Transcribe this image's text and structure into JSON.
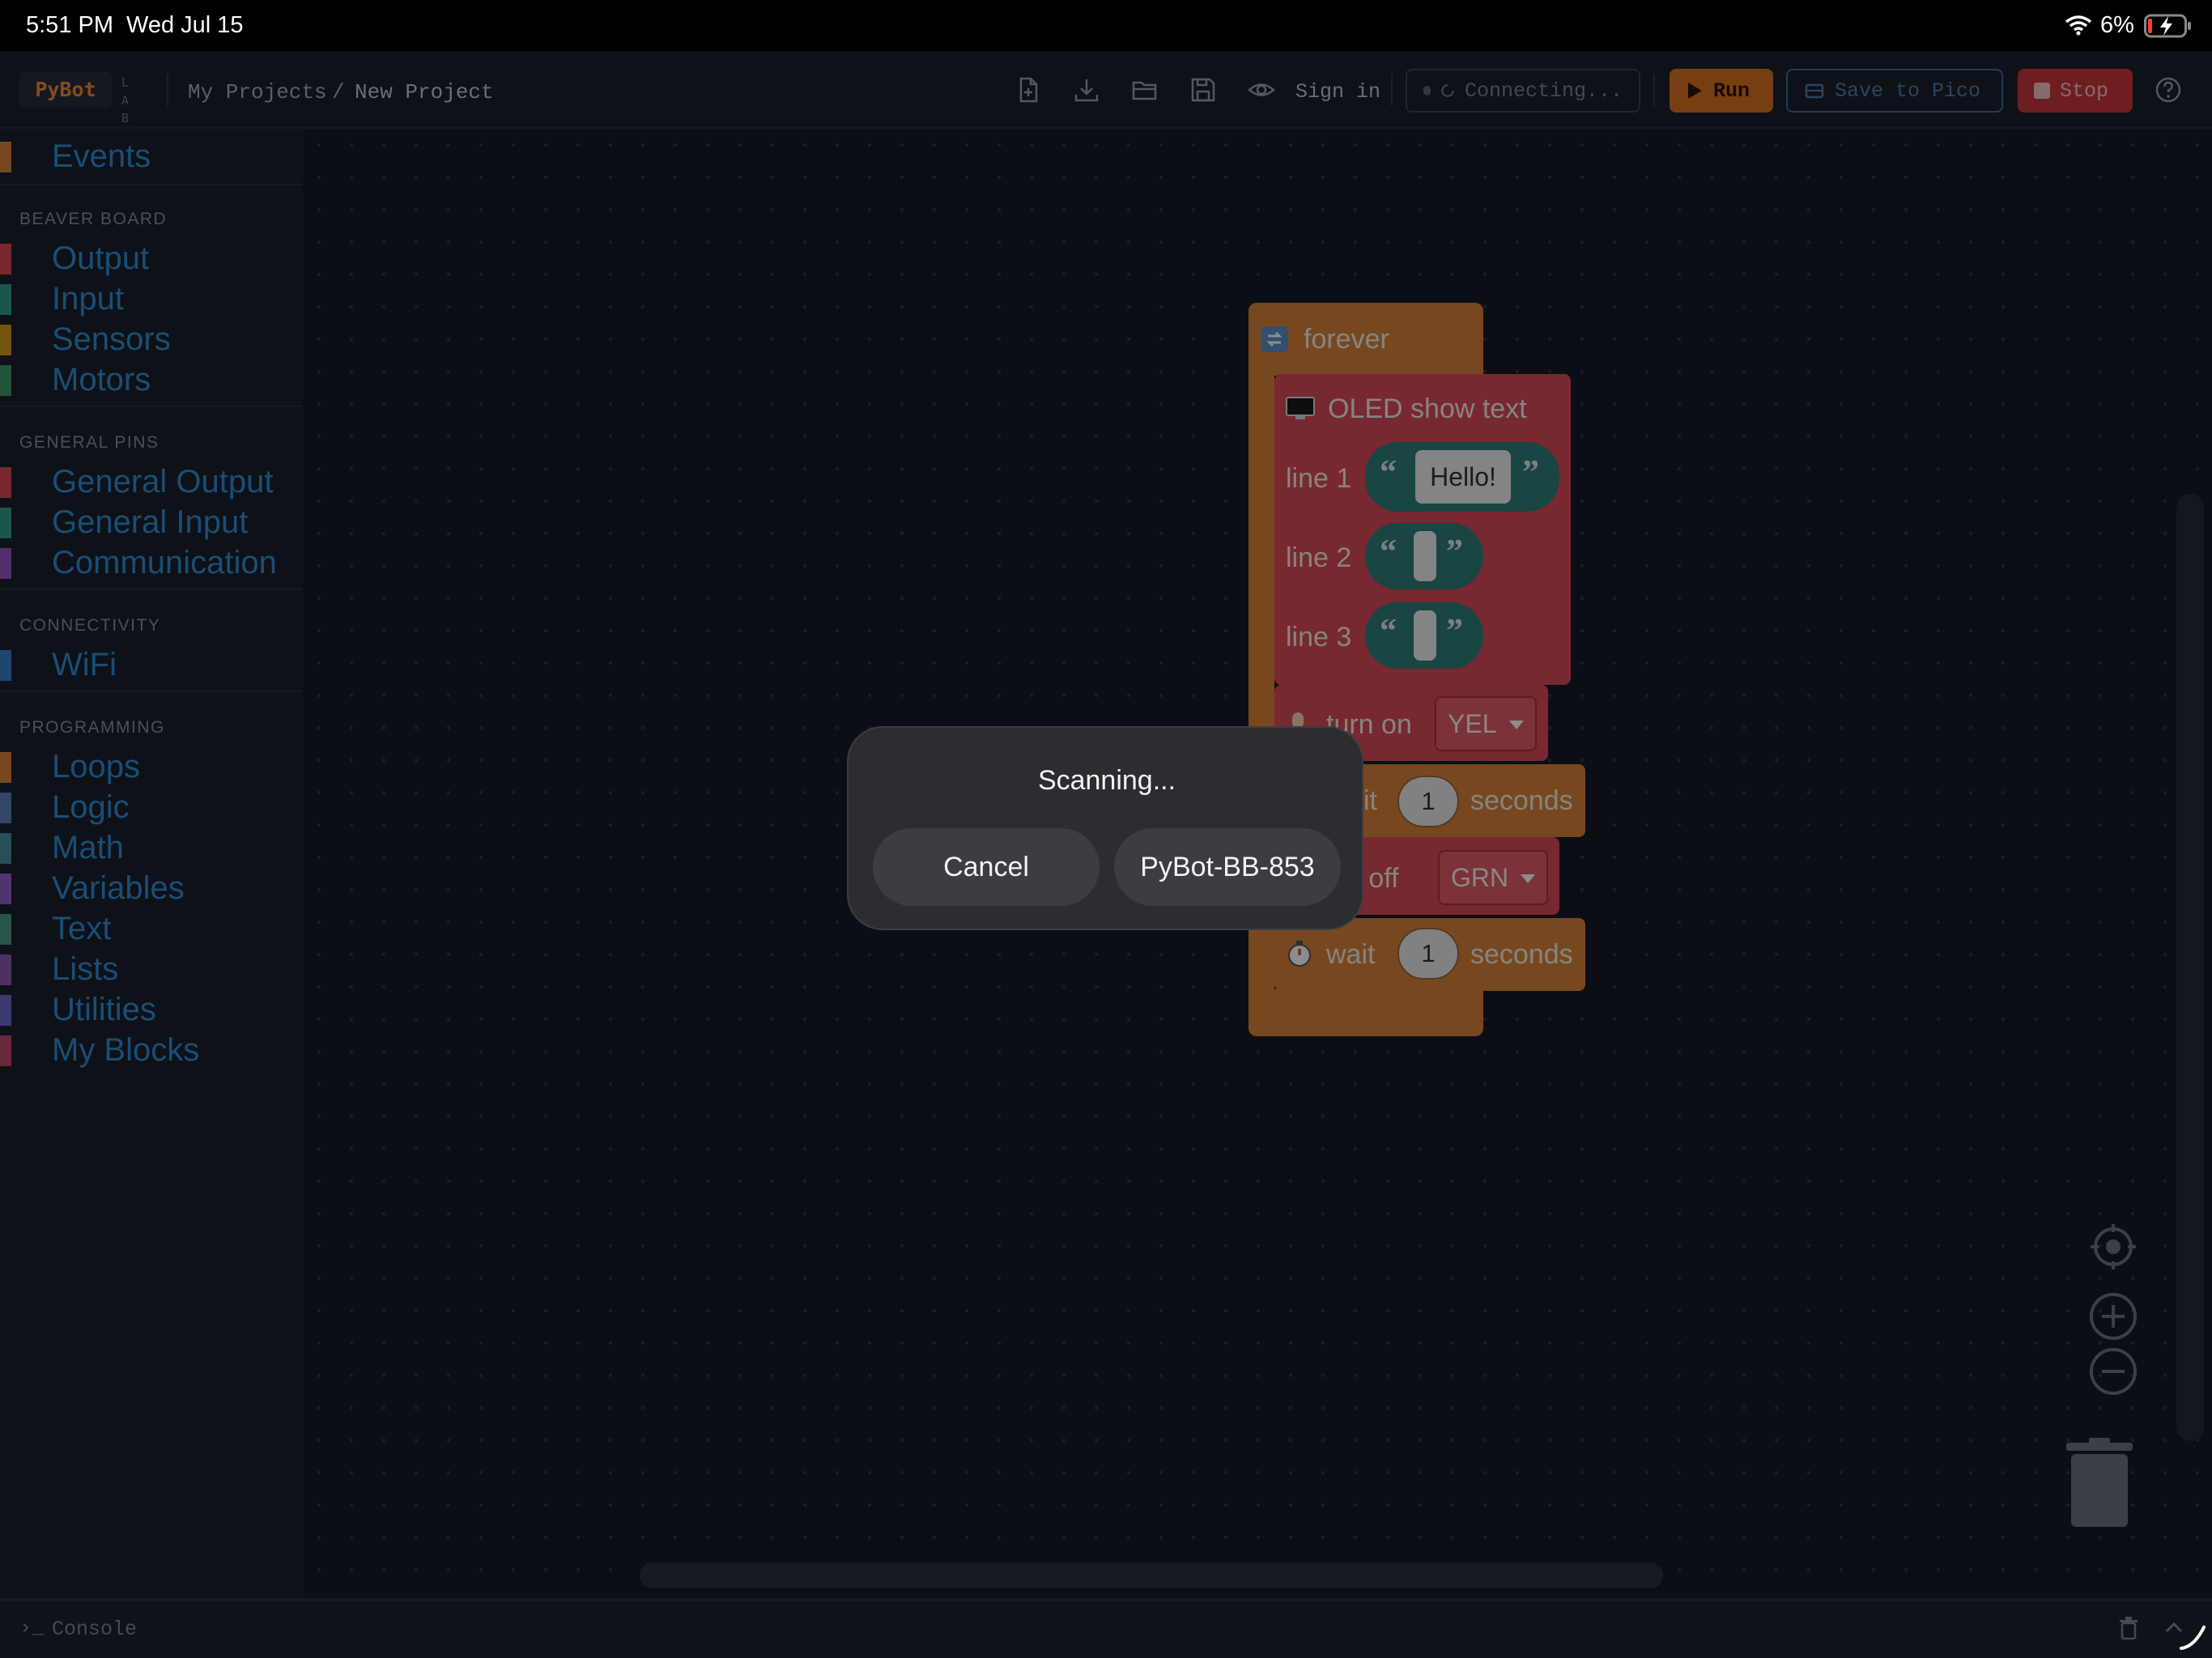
{
  "status_bar": {
    "time": "5:51 PM",
    "date": "Wed Jul 15",
    "battery_percent": "6%"
  },
  "header": {
    "logo": "PyBot",
    "labs_letters": [
      "L A",
      "B S"
    ],
    "breadcrumb": {
      "parent": "My Projects",
      "separator": "/",
      "current": "New Project"
    },
    "icons": [
      "new-file-icon",
      "download-icon",
      "open-folder-icon",
      "save-icon",
      "eye-icon"
    ],
    "sign_in": "Sign in",
    "connect_label": "Connecting...",
    "run_label": "Run",
    "save_to_pico_label": "Save to Pico",
    "stop_label": "Stop"
  },
  "sidebar": {
    "top_item": {
      "label": "Events",
      "color": "#d9843a"
    },
    "sections": [
      {
        "heading": "BEAVER BOARD",
        "items": [
          {
            "label": "Output",
            "color": "#d94a5a"
          },
          {
            "label": "Input",
            "color": "#2f9e8f"
          },
          {
            "label": "Sensors",
            "color": "#d89a1a"
          },
          {
            "label": "Motors",
            "color": "#3f9a6a"
          }
        ]
      },
      {
        "heading": "GENERAL PINS",
        "items": [
          {
            "label": "General Output",
            "color": "#d94a5a"
          },
          {
            "label": "General Input",
            "color": "#2f9e8f"
          },
          {
            "label": "Communication",
            "color": "#9a55c8"
          }
        ]
      },
      {
        "heading": "CONNECTIVITY",
        "items": [
          {
            "label": "WiFi",
            "color": "#3a7fd0"
          }
        ]
      },
      {
        "heading": "PROGRAMMING",
        "items": [
          {
            "label": "Loops",
            "color": "#d9843a"
          },
          {
            "label": "Logic",
            "color": "#5b80c0"
          },
          {
            "label": "Math",
            "color": "#4a8fa0"
          },
          {
            "label": "Variables",
            "color": "#9060c8"
          },
          {
            "label": "Text",
            "color": "#4a9a88"
          },
          {
            "label": "Lists",
            "color": "#8a5ab8"
          },
          {
            "label": "Utilities",
            "color": "#6a6ad0"
          },
          {
            "label": "My Blocks",
            "color": "#c04a70"
          }
        ]
      }
    ]
  },
  "blocks": {
    "forever": "forever",
    "oled": {
      "title": "OLED show text",
      "lines": [
        {
          "label": "line 1",
          "value": "Hello!"
        },
        {
          "label": "line 2",
          "value": ""
        },
        {
          "label": "line 3",
          "value": ""
        }
      ]
    },
    "turn_on": {
      "label": "turn on",
      "value": "YEL"
    },
    "wait_1": {
      "label_partial": "it",
      "value": "1",
      "unit": "seconds"
    },
    "turn_off": {
      "label_partial": "n off",
      "value": "GRN"
    },
    "wait_2": {
      "label": "wait",
      "value": "1",
      "unit": "seconds"
    },
    "quote_open": "“",
    "quote_close": "”"
  },
  "dialog": {
    "title": "Scanning...",
    "cancel_label": "Cancel",
    "device_label": "PyBot-BB-853"
  },
  "console": {
    "prompt": "›_",
    "label": "Console"
  },
  "colors": {
    "accent_orange": "#d9743f",
    "block_orange": "#d9843a",
    "block_red": "#d94a5a",
    "text_teal": "#2f7e78",
    "sidebar_link": "#2e8fd8"
  }
}
